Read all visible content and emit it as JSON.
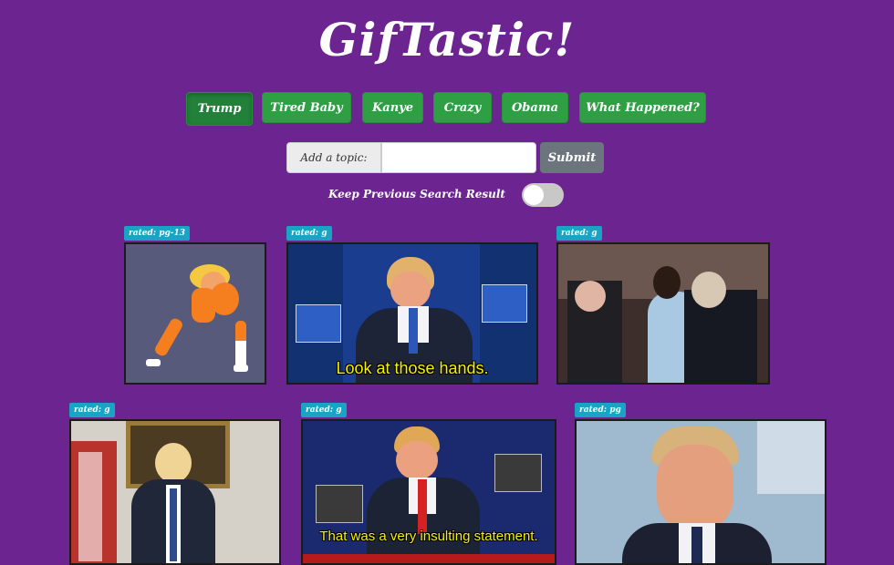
{
  "app": {
    "title": "GifTastic!"
  },
  "topics": [
    {
      "label": "Trump",
      "active": true
    },
    {
      "label": "Tired Baby",
      "active": false
    },
    {
      "label": "Kanye",
      "active": false
    },
    {
      "label": "Crazy",
      "active": false
    },
    {
      "label": "Obama",
      "active": false
    },
    {
      "label": "What Happened?",
      "active": false
    }
  ],
  "form": {
    "label": "Add a topic:",
    "input_value": "",
    "input_placeholder": "",
    "submit_label": "Submit"
  },
  "toggle": {
    "label": "Keep Previous Search Result",
    "on": false
  },
  "gifs": [
    {
      "rating": "rated: pg-13",
      "caption": ""
    },
    {
      "rating": "rated: g",
      "caption": "Look at those hands."
    },
    {
      "rating": "rated: g",
      "caption": ""
    },
    {
      "rating": "rated: g",
      "caption": ""
    },
    {
      "rating": "rated: g",
      "caption": "That was a very insulting statement."
    },
    {
      "rating": "rated: pg",
      "caption": ""
    }
  ],
  "colors": {
    "background": "#6b2490",
    "button": "#2ea043",
    "badge": "#1aa3c5",
    "submit": "#6c757d"
  }
}
